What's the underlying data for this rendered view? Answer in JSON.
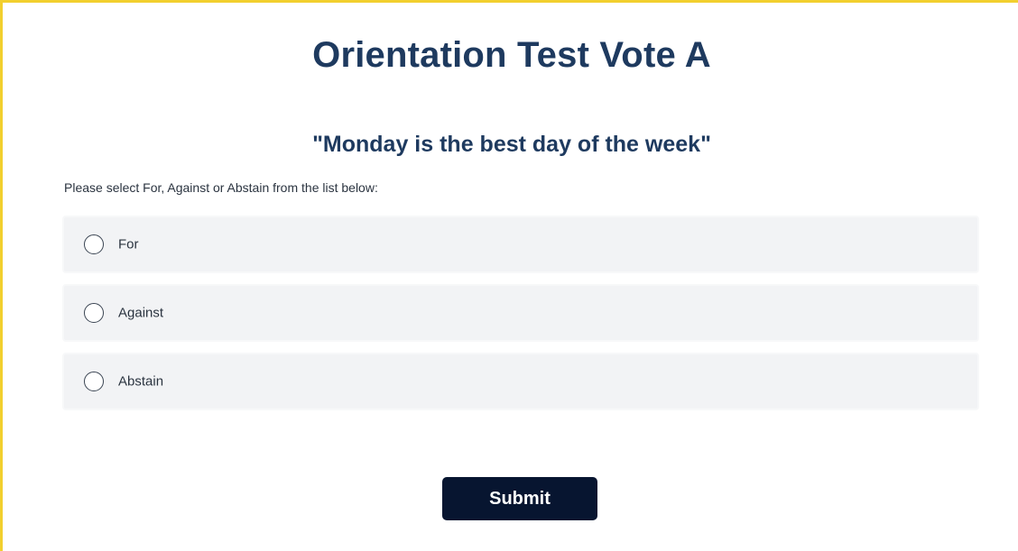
{
  "page": {
    "title": "Orientation Test Vote A",
    "question": "\"Monday is the best day of the week\"",
    "instruction": "Please select For, Against or Abstain from the list below:"
  },
  "options": [
    {
      "label": "For",
      "selected": false
    },
    {
      "label": "Against",
      "selected": false
    },
    {
      "label": "Abstain",
      "selected": false
    }
  ],
  "submit": {
    "label": "Submit"
  },
  "colors": {
    "accent_border": "#f2cf2e",
    "heading": "#1e3a5f",
    "button_bg": "#071530",
    "option_bg": "#f2f3f5"
  },
  "icons": {
    "radio": "radio-unchecked-icon"
  }
}
